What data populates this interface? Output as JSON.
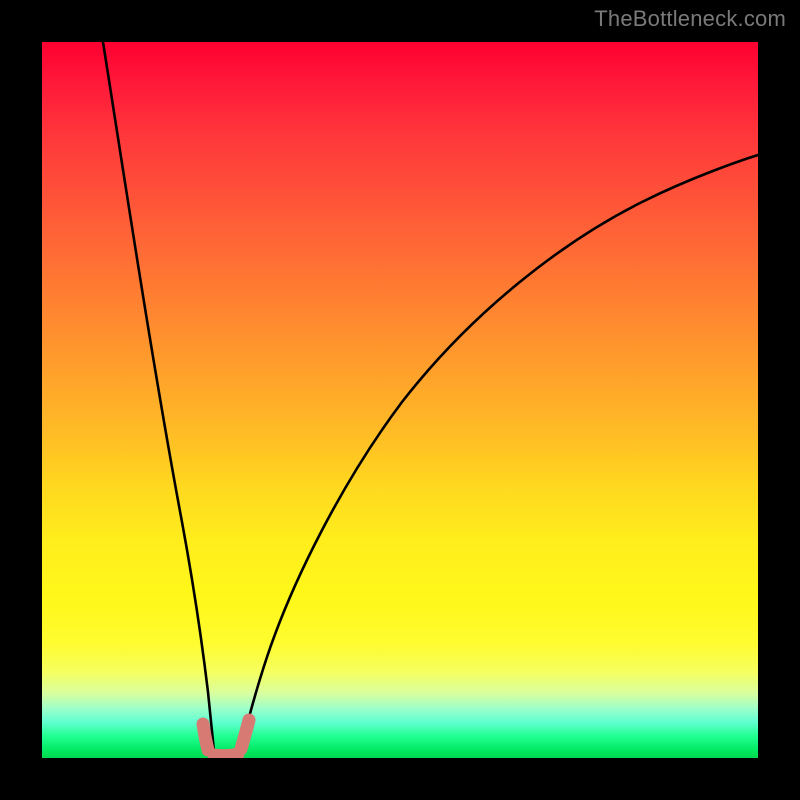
{
  "watermark": "TheBottleneck.com",
  "chart_data": {
    "type": "line",
    "title": "",
    "xlabel": "",
    "ylabel": "",
    "xlim": [
      0,
      100
    ],
    "ylim": [
      0,
      100
    ],
    "grid": false,
    "legend": false,
    "background_gradient": {
      "stops": [
        {
          "pos": 0,
          "color": "#ff0030"
        },
        {
          "pos": 50,
          "color": "#ffba26"
        },
        {
          "pos": 80,
          "color": "#fff81a"
        },
        {
          "pos": 100,
          "color": "#00d850"
        }
      ]
    },
    "series": [
      {
        "name": "left-branch",
        "x": [
          8.5,
          10,
          12,
          14,
          16,
          18,
          20,
          21,
          22,
          23,
          23.7
        ],
        "y": [
          100,
          90,
          77,
          64,
          51,
          37,
          22,
          14,
          8,
          3,
          0.5
        ]
      },
      {
        "name": "right-branch",
        "x": [
          27.6,
          28.5,
          30,
          33,
          37,
          42,
          48,
          55,
          63,
          72,
          82,
          92,
          100
        ],
        "y": [
          0.5,
          3,
          8,
          16,
          26,
          35,
          44,
          52,
          60,
          67,
          73,
          79,
          83
        ]
      },
      {
        "name": "trough-segments",
        "segments": [
          {
            "x": [
              22.5,
              22.9,
              23.7
            ],
            "y": [
              4.5,
              2.0,
              0.6
            ]
          },
          {
            "x": [
              24.0,
              26.0,
              27.3
            ],
            "y": [
              0.3,
              0.3,
              0.6
            ]
          },
          {
            "x": [
              27.6,
              28.2,
              28.9
            ],
            "y": [
              0.9,
              2.8,
              5.2
            ]
          }
        ],
        "stroke": "#d87a74",
        "stroke_width": 10
      }
    ]
  }
}
